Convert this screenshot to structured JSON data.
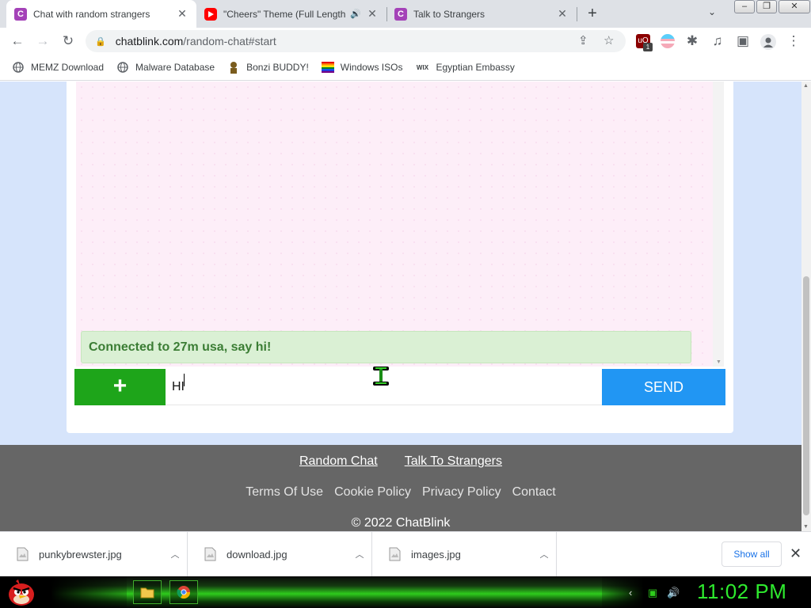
{
  "browser": {
    "tabs": [
      {
        "title": "Chat with random strangers",
        "favicon": "C",
        "favicon_color": "#a442b8",
        "active": true
      },
      {
        "title": "\"Cheers\" Theme (Full Length",
        "favicon": "youtube-icon",
        "favicon_color": "#ff0000",
        "audio": true,
        "active": false
      },
      {
        "title": "Talk to Strangers",
        "favicon": "C",
        "favicon_color": "#a442b8",
        "active": false
      }
    ],
    "url_host": "chatblink.com",
    "url_path": "/random-chat#start",
    "extension_badge": "1",
    "bookmarks": [
      {
        "label": "MEMZ Download",
        "icon": "globe-icon"
      },
      {
        "label": "Malware Database",
        "icon": "globe-icon"
      },
      {
        "label": "Bonzi BUDDY!",
        "icon": "bonzi-icon"
      },
      {
        "label": "Windows ISOs",
        "icon": "rainbow-flag-icon"
      },
      {
        "label": "Egyptian Embassy",
        "icon": "wix-icon",
        "icon_text": "WIX"
      }
    ]
  },
  "chat": {
    "status_message": "Connected to 27m usa, say hi!",
    "input_value": "HI",
    "add_button": "+",
    "send_button": "SEND"
  },
  "footer": {
    "primary_links": [
      "Random Chat",
      "Talk To Strangers"
    ],
    "secondary_links": [
      "Terms Of Use",
      "Cookie Policy",
      "Privacy Policy",
      "Contact"
    ],
    "copyright": "© 2022 ChatBlink"
  },
  "downloads": {
    "items": [
      "punkybrewster.jpg",
      "download.jpg",
      "images.jpg"
    ],
    "show_all": "Show all"
  },
  "taskbar": {
    "clock": "11:02 PM"
  },
  "colors": {
    "accent_green": "#1ea51a",
    "send_blue": "#2196f3",
    "status_bg": "#daf0d4",
    "status_text": "#3b7d34",
    "page_bg": "#d6e4fb",
    "footer_bg": "#666666"
  }
}
